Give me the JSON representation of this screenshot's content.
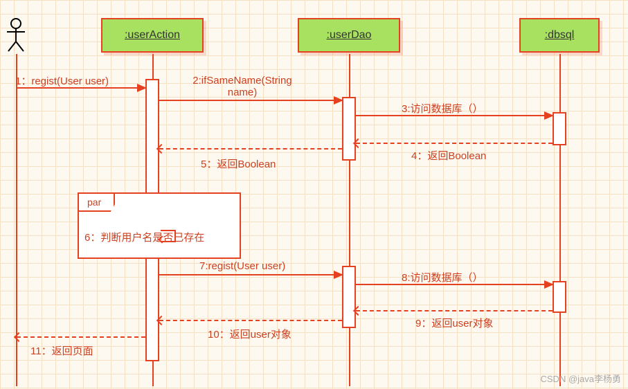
{
  "lifelines": {
    "userAction": ":userAction",
    "userDao": ":userDao",
    "dbsql": ":dbsql"
  },
  "frag": {
    "tab": "par",
    "text": "6：判断用户名是否已存在"
  },
  "messages": {
    "m1": "1：regist(User user)",
    "m2": "2:ifSameName(String name)",
    "m3": "3:访问数据库（）",
    "m4": "4：返回Boolean",
    "m5": "5：返回Boolean",
    "m7": "7:regist(User user)",
    "m8": "8:访问数据库（）",
    "m9": "9：返回user对象",
    "m10": "10：返回user对象",
    "m11": "11：返回页面"
  },
  "watermark": "CSDN @java李杨勇"
}
